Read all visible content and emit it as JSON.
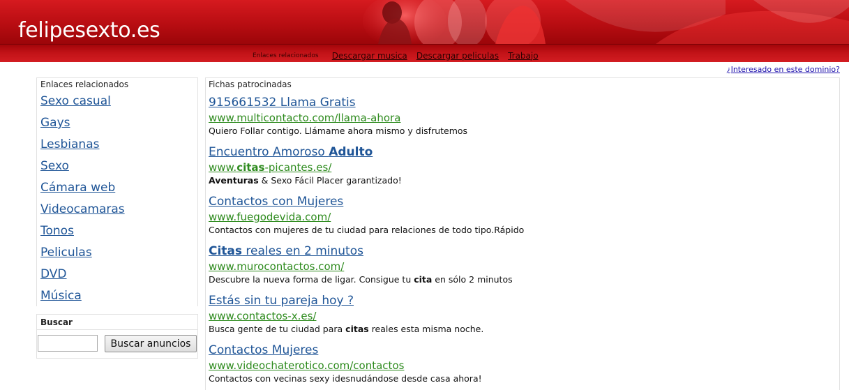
{
  "header": {
    "site_title": "felipesexto.es",
    "nav_label": "Enlaces relacionados",
    "nav_links": [
      "Descargar musica",
      "Descargar peliculas",
      "Trabajo"
    ]
  },
  "domain_link": "¿Interesado en este dominio?",
  "related": {
    "title": "Enlaces relacionados",
    "items": [
      "Sexo casual",
      "Gays",
      "Lesbianas",
      "Sexo",
      "Cámara web",
      "Videocamaras",
      "Tonos",
      "Peliculas",
      "DVD",
      "Música"
    ]
  },
  "search": {
    "title": "Buscar",
    "input_value": "",
    "button_label": "Buscar anuncios"
  },
  "sponsored": {
    "title": "Fichas patrocinadas",
    "ads": [
      {
        "title": [
          {
            "t": "915661532 Llama Gratis",
            "b": false
          }
        ],
        "url": [
          {
            "t": "www.multicontacto.com/llama-ahora",
            "b": false
          }
        ],
        "desc": [
          {
            "t": "Quiero Follar contigo. Llámame ahora mismo y disfrutemos",
            "b": false
          }
        ]
      },
      {
        "title": [
          {
            "t": "Encuentro Amoroso ",
            "b": false
          },
          {
            "t": "Adulto",
            "b": true
          }
        ],
        "url": [
          {
            "t": "www.",
            "b": false
          },
          {
            "t": "citas",
            "b": true
          },
          {
            "t": "-picantes.es/",
            "b": false
          }
        ],
        "desc": [
          {
            "t": "Aventuras",
            "b": true
          },
          {
            "t": " & Sexo Fácil Placer garantizado!",
            "b": false
          }
        ]
      },
      {
        "title": [
          {
            "t": "Contactos con Mujeres",
            "b": false
          }
        ],
        "url": [
          {
            "t": "www.fuegodevida.com/",
            "b": false
          }
        ],
        "desc": [
          {
            "t": "Contactos con mujeres de tu ciudad para relaciones de todo tipo.Rápido",
            "b": false
          }
        ]
      },
      {
        "title": [
          {
            "t": "Citas",
            "b": true
          },
          {
            "t": " reales en 2 minutos",
            "b": false
          }
        ],
        "url": [
          {
            "t": "www.murocontactos.com/",
            "b": false
          }
        ],
        "desc": [
          {
            "t": "Descubre la nueva forma de ligar. Consigue tu ",
            "b": false
          },
          {
            "t": "cita",
            "b": true
          },
          {
            "t": " en sólo 2 minutos",
            "b": false
          }
        ]
      },
      {
        "title": [
          {
            "t": "Estás sin tu pareja hoy ?",
            "b": false
          }
        ],
        "url": [
          {
            "t": "www.contactos-x.es/",
            "b": false
          }
        ],
        "desc": [
          {
            "t": "Busca gente de tu ciudad para ",
            "b": false
          },
          {
            "t": "citas",
            "b": true
          },
          {
            "t": " reales esta misma noche.",
            "b": false
          }
        ]
      },
      {
        "title": [
          {
            "t": "Contactos Mujeres",
            "b": false
          }
        ],
        "url": [
          {
            "t": "www.videochaterotico.com/contactos",
            "b": false
          }
        ],
        "desc": [
          {
            "t": "Contactos con vecinas sexy idesnudándose desde casa ahora!",
            "b": false
          }
        ]
      }
    ]
  },
  "colors": {
    "header_red": "#c8141a",
    "link_blue": "#1f5597",
    "url_green": "#2e8b1e"
  }
}
